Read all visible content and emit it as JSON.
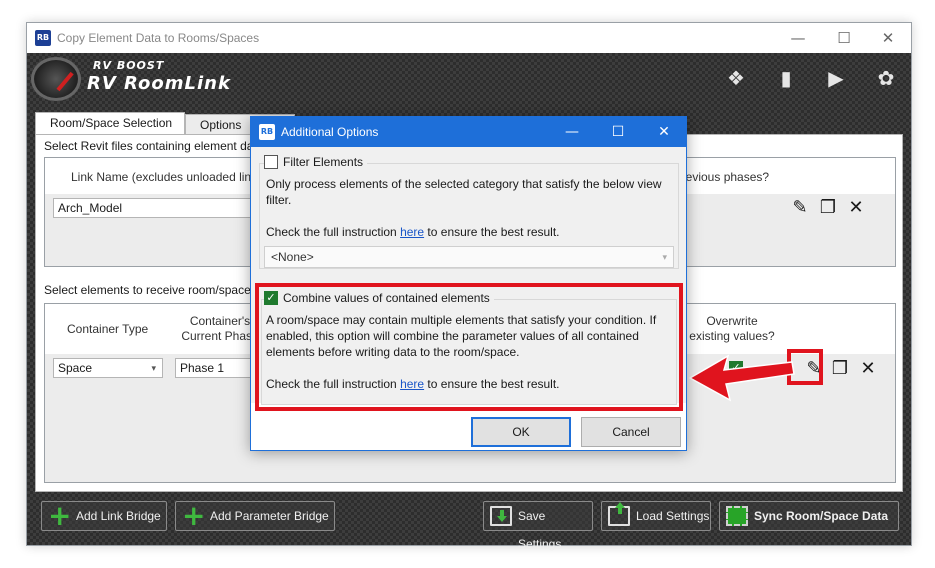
{
  "window": {
    "app_icon": "RB",
    "title": "Copy Element Data to Rooms/Spaces",
    "controls": [
      "—",
      "☐",
      "✕"
    ]
  },
  "header": {
    "brand_small": "RV BOOST",
    "brand_big": "RV RoomLink",
    "icons": [
      "package-icon",
      "manual-icon",
      "video-icon",
      "community-icon"
    ]
  },
  "tabs": [
    {
      "label": "Room/Space Selection",
      "active": true
    },
    {
      "label": "Options",
      "active": false
    }
  ],
  "section1": {
    "title": "Select Revit files containing element data",
    "col_link_name": "Link Name (excludes unloaded links)",
    "col_previous_phases": "previous phases?",
    "row_link_value": "Arch_Model"
  },
  "section2": {
    "title": "Select elements to receive room/space data",
    "col_container_type": "Container Type",
    "col_container_phase": "Container's Current Phase",
    "col_overwrite": "Overwrite existing values?",
    "row_container_type": "Space",
    "row_phase": "Phase 1"
  },
  "footer": {
    "add_link_bridge": "Add Link Bridge",
    "add_parameter_bridge": "Add Parameter Bridge",
    "save_settings": "Save Settings",
    "load_settings": "Load Settings",
    "sync": "Sync Room/Space Data"
  },
  "dialog": {
    "app_icon": "RB",
    "title": "Additional Options",
    "filter": {
      "label": "Filter Elements",
      "checked": false,
      "description": "Only process elements of the selected category that satisfy the below view filter.",
      "instruction_prefix": "Check the full instruction ",
      "instruction_link": "here",
      "instruction_suffix": " to ensure the best result.",
      "combo_value": "<None>"
    },
    "combine": {
      "label": "Combine values of contained elements",
      "checked": true,
      "description": "A room/space may contain multiple elements that satisfy your condition. If enabled, this option will combine the parameter values of all contained elements before writing data to the room/space.",
      "instruction_prefix": "Check the full instruction ",
      "instruction_link": "here",
      "instruction_suffix": " to ensure the best result."
    },
    "ok": "OK",
    "cancel": "Cancel"
  },
  "colors": {
    "accent": "#1e6fd9",
    "highlight": "#e0141e",
    "check_green": "#1f7a2e",
    "plus_green": "#3fb83f"
  }
}
